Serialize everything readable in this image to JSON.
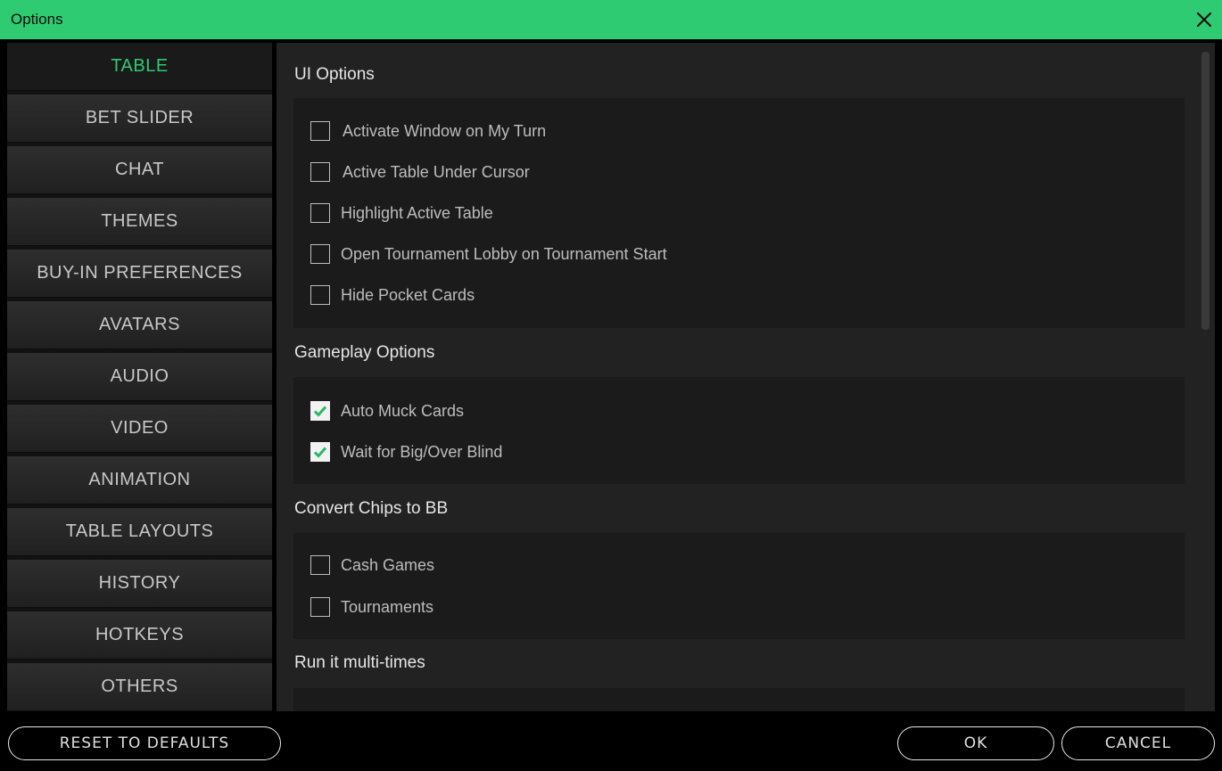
{
  "window": {
    "title": "Options"
  },
  "colors": {
    "accent": "#2ecb72",
    "checkmark": "#27b866"
  },
  "sidebar": {
    "items": [
      {
        "label": "TABLE",
        "active": true
      },
      {
        "label": "BET SLIDER"
      },
      {
        "label": "CHAT"
      },
      {
        "label": "THEMES"
      },
      {
        "label": "BUY-IN PREFERENCES"
      },
      {
        "label": "AVATARS"
      },
      {
        "label": "AUDIO"
      },
      {
        "label": "VIDEO"
      },
      {
        "label": "ANIMATION"
      },
      {
        "label": "TABLE LAYOUTS"
      },
      {
        "label": "HISTORY"
      },
      {
        "label": "HOTKEYS"
      },
      {
        "label": "OTHERS"
      }
    ]
  },
  "sections": {
    "ui": {
      "title": "UI Options",
      "options": [
        {
          "label": "Activate Window on My Turn",
          "checked": false
        },
        {
          "label": "Active Table Under Cursor",
          "checked": false
        },
        {
          "label": "Highlight Active Table",
          "checked": false
        },
        {
          "label": "Open Tournament Lobby on Tournament Start",
          "checked": false
        },
        {
          "label": "Hide Pocket Cards",
          "checked": false
        }
      ]
    },
    "gameplay": {
      "title": "Gameplay Options",
      "options": [
        {
          "label": "Auto Muck Cards",
          "checked": true
        },
        {
          "label": "Wait for Big/Over Blind",
          "checked": true
        }
      ]
    },
    "convert": {
      "title": "Convert Chips to BB",
      "options": [
        {
          "label": "Cash Games",
          "checked": false
        },
        {
          "label": "Tournaments",
          "checked": false
        }
      ]
    },
    "run": {
      "title": "Run it multi-times"
    }
  },
  "footer": {
    "reset": "RESET TO DEFAULTS",
    "ok": "OK",
    "cancel": "CANCEL"
  },
  "icons": {
    "close": "close-icon",
    "check": "checkmark-icon"
  }
}
